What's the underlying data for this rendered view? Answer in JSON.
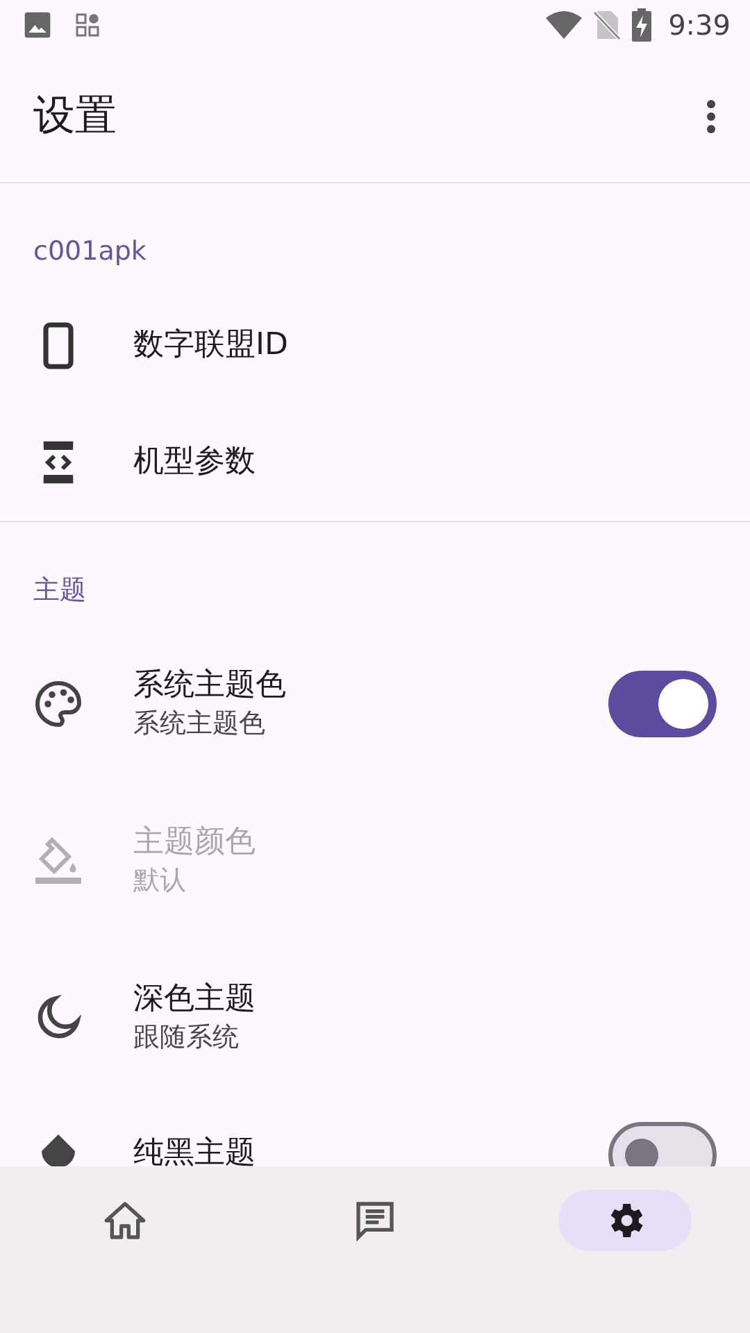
{
  "status_bar": {
    "time": "9:39"
  },
  "app_bar": {
    "title": "设置"
  },
  "sections": [
    {
      "header": "c001apk",
      "items": [
        {
          "kind": "link",
          "title": "数字联盟ID",
          "disabled": false
        },
        {
          "kind": "link",
          "title": "机型参数",
          "disabled": false
        }
      ]
    },
    {
      "header": "主题",
      "items": [
        {
          "kind": "switch",
          "title": "系统主题色",
          "summary": "系统主题色",
          "on": true,
          "disabled": false
        },
        {
          "kind": "link",
          "title": "主题颜色",
          "summary": "默认",
          "disabled": true
        },
        {
          "kind": "link",
          "title": "深色主题",
          "summary": "跟随系统",
          "disabled": false
        },
        {
          "kind": "switch",
          "title": "纯黑主题",
          "on": false,
          "disabled": false
        }
      ]
    }
  ],
  "bottom_nav": [
    {
      "selected": false
    },
    {
      "selected": false
    },
    {
      "selected": true
    }
  ]
}
